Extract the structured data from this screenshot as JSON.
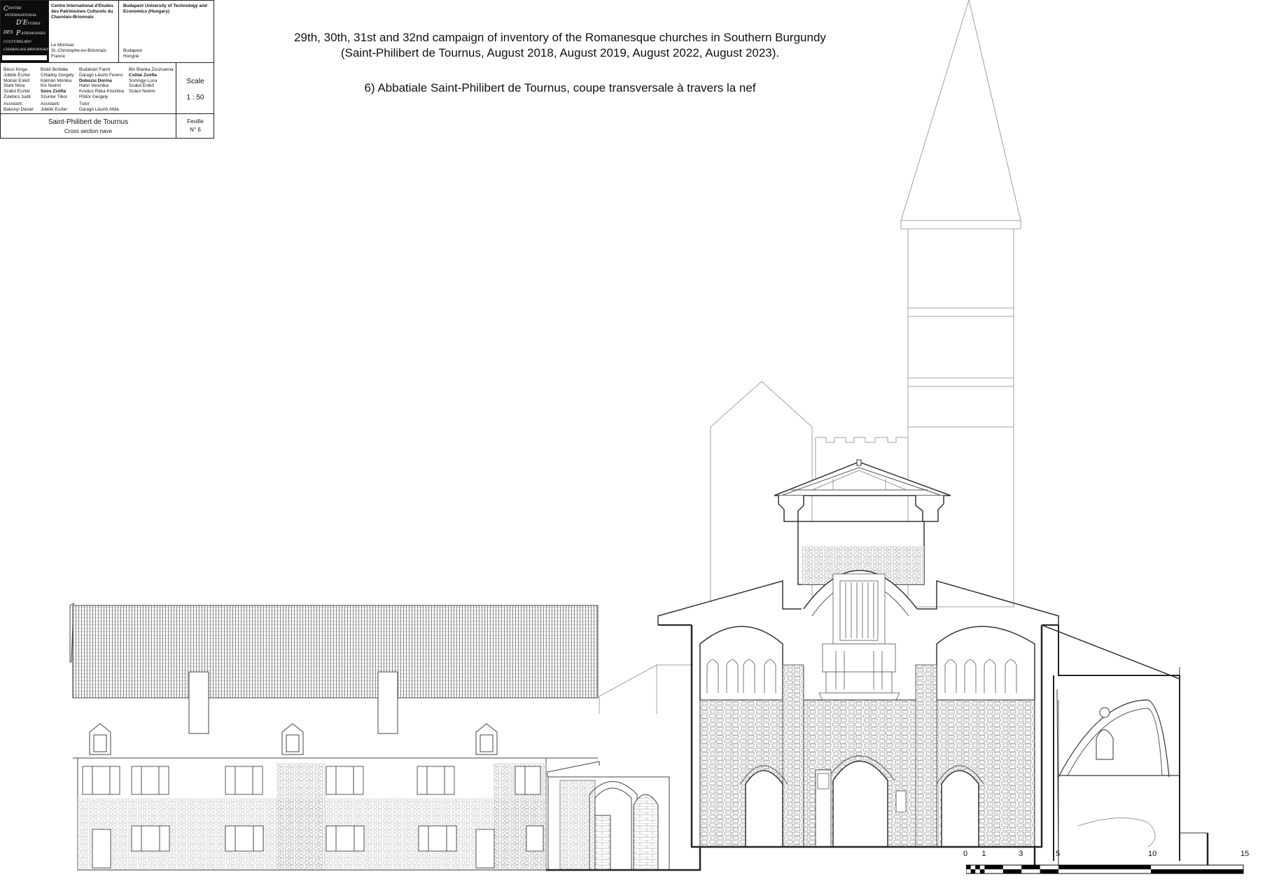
{
  "title_block": {
    "org1_name": "Centre International d'Etudes des Patrimoines Culturels du Charolais-Brionnais",
    "org1_address": [
      "Le Montsac",
      "St.-Christophe-en-Brionnais",
      "France"
    ],
    "org2_name": "Budapest University of Technology and Economics (Hungary)",
    "org2_address": [
      "Budapest",
      "Hongrie"
    ],
    "logo_text": "CENTRE INTERNATIONAL D'ETUDES DES PATRIMOINES CULTURELS DU CHAROLAIS-BRIONNAIS",
    "team_col1": [
      "Bácsi Kinga",
      "Jobbik Eszter",
      "Molnár Enikő",
      "Stahl Nóra",
      "Szabó Eszter",
      "Zslebics Judit"
    ],
    "team_col2": [
      "Bodó Borbála",
      "Chladny Gergely",
      "Kálmán Mónika",
      "Kis Noémi",
      "Soos Zsófia",
      "Szunter Tibor"
    ],
    "team_col3": [
      "Budaházi Fanni",
      "Daragó László Ferenc",
      "Dobozsi Dorina",
      "Hahn Veronika",
      "Kovács Réka Krisztina",
      "Pődör Gergely"
    ],
    "team_col4": [
      "Biri Blanka Zsuzsanna",
      "Csölai Zsófia",
      "Somogyi Luca",
      "Szabó Enikő",
      "Szász Noémi"
    ],
    "assistant1_label": "Assistant:",
    "assistant1_name": "Bakonyi Dániel",
    "assistant2_label": "Assistant:",
    "assistant2_name": "Jobbik Eszter",
    "tutor_label": "Tutor:",
    "tutor_name": "Daragó László Attila",
    "scale_label": "Scale",
    "scale_value": "1 : 50",
    "project_name": "Saint-Philibert de Tournus",
    "drawing_subtitle": "Cross section nave",
    "sheet_label": "Feuille",
    "sheet_number": "N° 6"
  },
  "heading": {
    "line1": "29th, 30th, 31st and 32nd campaign of inventory of the Romanesque churches in Southern Burgundy",
    "line2": "(Saint-Philibert de Tournus, August 2018, August 2019, August 2022, August 2023).",
    "line3": "6) Abbatiale Saint-Philibert de Tournus, coupe transversale à travers la nef"
  },
  "scale_bar": {
    "labels": [
      "0",
      "1",
      "3",
      "5",
      "10",
      "15"
    ],
    "units": [
      0,
      1,
      3,
      5,
      10,
      15
    ]
  }
}
